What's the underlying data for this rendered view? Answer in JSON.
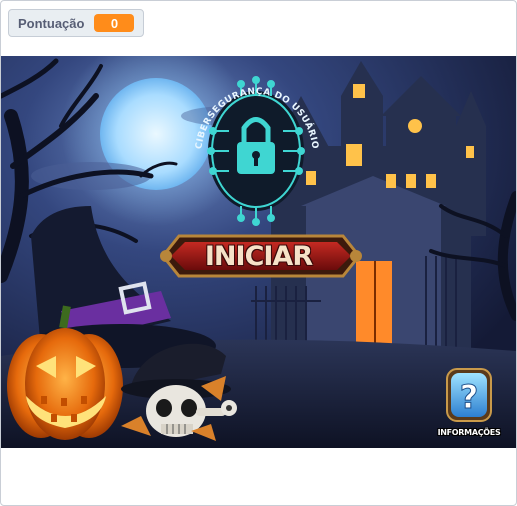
{
  "score": {
    "label": "Pontuação",
    "value": "0"
  },
  "logo": {
    "text": "CIBERSEGURANÇA DO USUÁRIO",
    "icon": "padlock-icon"
  },
  "start_button": {
    "label": "INICIAR"
  },
  "info_button": {
    "label": "INFORMAÇÕES",
    "icon": "question-mark-icon"
  },
  "colors": {
    "score_accent": "#ff8c1a",
    "sky": "#2a3a6a",
    "moon": "#bfe6ff",
    "logo_cyan": "#3fd6d2",
    "button_red": "#9b1414"
  }
}
